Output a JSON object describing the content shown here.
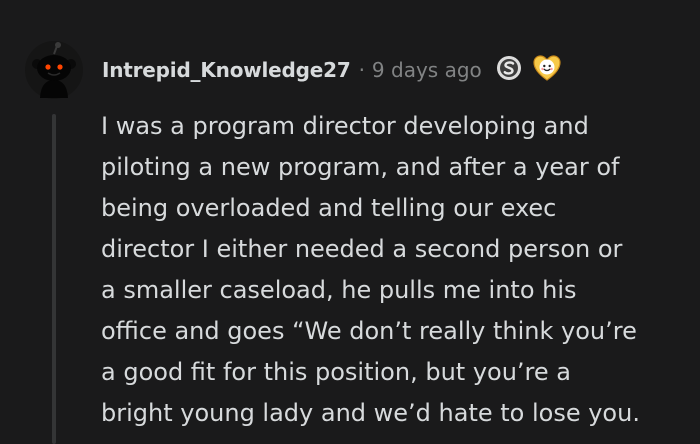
{
  "comment": {
    "author": "Intrepid_Knowledge27",
    "separator": "·",
    "timestamp": "9 days ago",
    "icons": [
      "silver-award-icon",
      "wholesome-award-icon",
      "snoo-avatar-icon"
    ],
    "body_lines": [
      "I was a program director developing and",
      "piloting a new program, and after a year of",
      "being overloaded and telling our exec",
      "director I either needed a second person or",
      "a smaller caseload, he pulls me into his",
      "office and goes “We don’t really think you’re",
      "a good fit for this position, but you’re a",
      "bright young lady and we’d hate to lose you."
    ]
  },
  "colors": {
    "background": "#1a1a1b",
    "text": "#d7dadc",
    "muted": "#818384",
    "thread_line": "#343536",
    "avatar_eye": "#ff4500"
  }
}
